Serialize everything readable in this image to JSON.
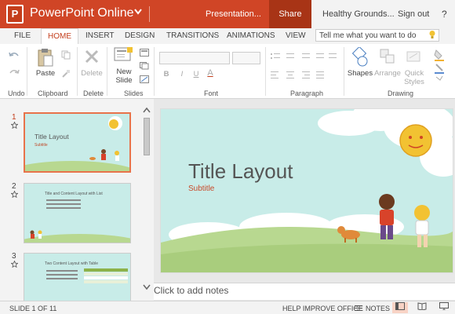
{
  "titlebar": {
    "logo_letter": "P",
    "app_name": "PowerPoint Online",
    "chevron": "❯",
    "document_title": "Presentation...",
    "share_label": "Share",
    "user_name": "Healthy Grounds...",
    "sign_out": "Sign out",
    "help_icon": "?"
  },
  "tabs": [
    "FILE",
    "HOME",
    "INSERT",
    "DESIGN",
    "TRANSITIONS",
    "ANIMATIONS",
    "VIEW"
  ],
  "active_tab": "HOME",
  "tell_me": {
    "placeholder": "Tell me what you want to do"
  },
  "ribbon": {
    "groups": [
      "Undo",
      "Clipboard",
      "Delete",
      "Slides",
      "Font",
      "Paragraph",
      "Drawing"
    ],
    "paste": "Paste",
    "delete": "Delete",
    "new_slide": "New Slide",
    "shapes": "Shapes",
    "arrange": "Arrange",
    "quick_styles": "Quick Styles",
    "bold": "B",
    "italic": "I",
    "underline": "U",
    "font_color": "A"
  },
  "thumbnails": [
    {
      "number": "1",
      "title": "Title Layout",
      "subtitle": "Subtitle",
      "active": true
    },
    {
      "number": "2",
      "title": "Title and Content Layout with List",
      "active": false
    },
    {
      "number": "3",
      "title": "Two Content Layout with Table",
      "active": false
    }
  ],
  "slide": {
    "title": "Title Layout",
    "subtitle": "Subtitle"
  },
  "notes_placeholder": "Click to add notes",
  "status": {
    "slide_counter": "SLIDE 1 OF 11",
    "help_improve": "HELP IMPROVE OFFICE",
    "notes": "NOTES"
  },
  "colors": {
    "accent": "#d04526",
    "share_bg": "#a83416",
    "slide_bg": "#c8ece8",
    "grass": "#b8d890"
  }
}
